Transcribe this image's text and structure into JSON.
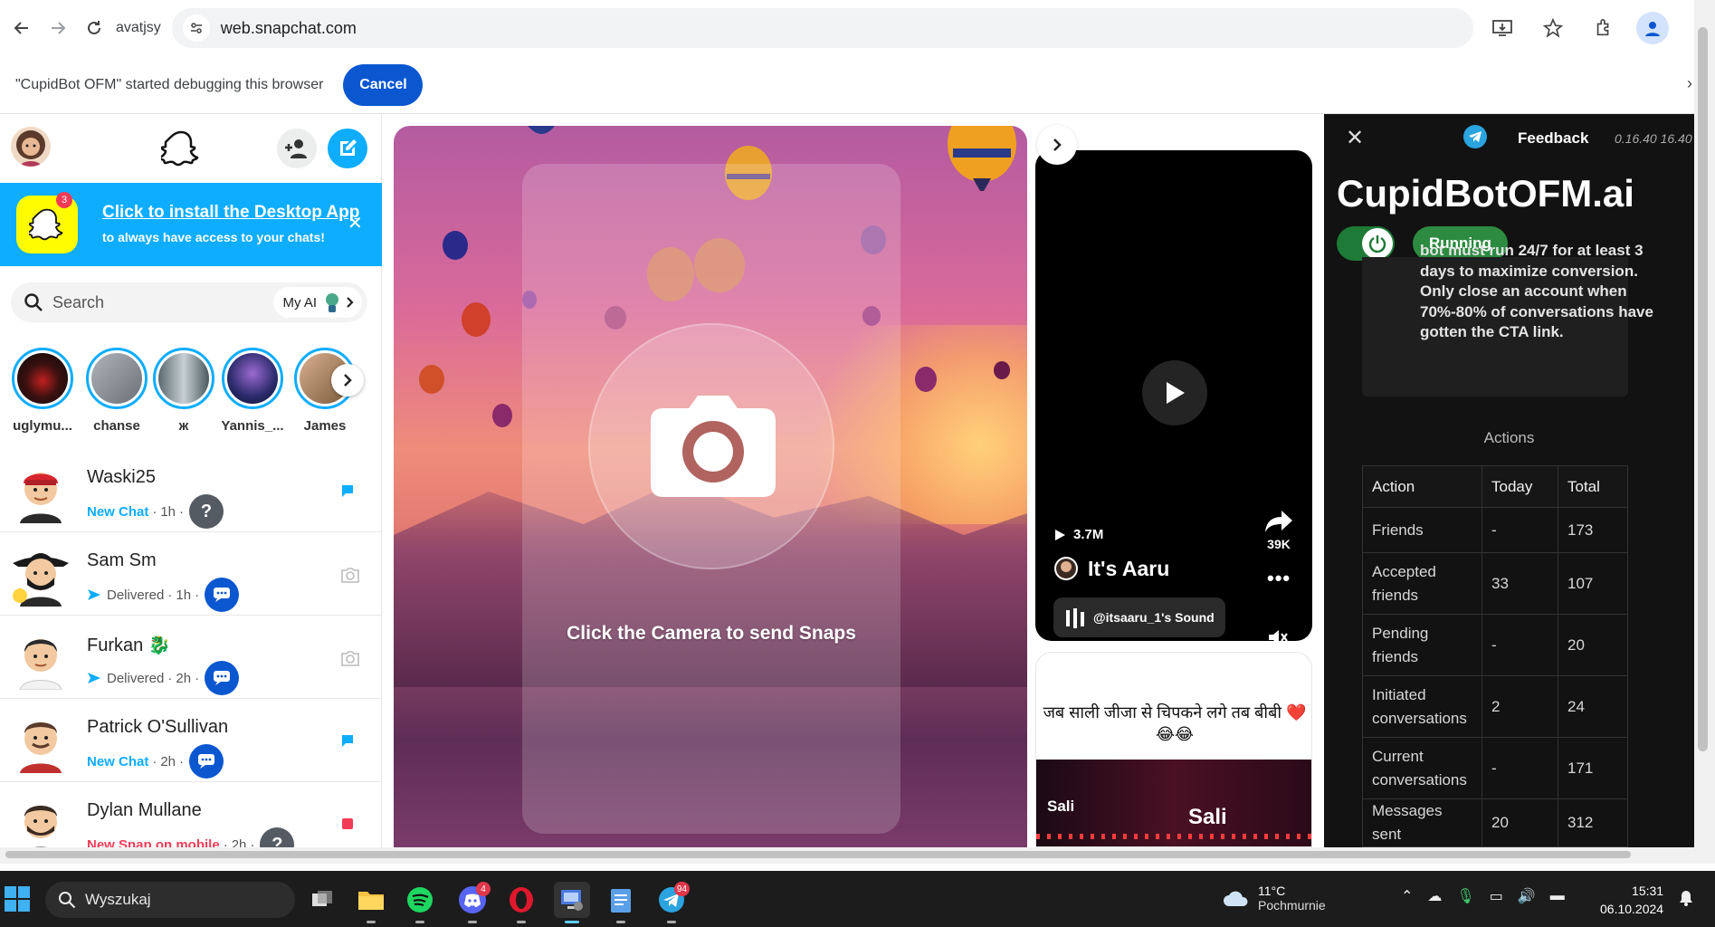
{
  "browser": {
    "profile_name": "avatjsy",
    "url": "web.snapchat.com"
  },
  "debug_bar": {
    "message": "\"CupidBot OFM\" started debugging this browser",
    "cancel_label": "Cancel"
  },
  "snapchat": {
    "install_banner": {
      "title": "Click to install the Desktop App",
      "subtitle": "to always have access to your chats!",
      "badge": "3"
    },
    "search": {
      "placeholder": "Search",
      "my_ai_label": "My AI"
    },
    "stories": [
      {
        "name": "uglymu...",
        "color": "#3a1010"
      },
      {
        "name": "chanse",
        "color": "#8a8f95"
      },
      {
        "name": "ж",
        "color": "#6e7a80"
      },
      {
        "name": "Yannis_...",
        "color": "#2a2a6a"
      },
      {
        "name": "James",
        "color": "#a07a5a"
      }
    ],
    "chats": [
      {
        "name": "Waski25",
        "status_type": "new",
        "status": "New Chat",
        "time": "1h",
        "pill": "?",
        "pill_color": "#555b63",
        "right": "blue-chat",
        "skin": "#f2c9a0",
        "hat": "#d7262f"
      },
      {
        "name": "Sam Sm",
        "status_type": "delivered",
        "status": "Delivered",
        "time": "1h",
        "pill": "chat",
        "pill_color": "#0b57d0",
        "right": "camera",
        "skin": "#f2c9a0",
        "hat": "#222"
      },
      {
        "name": "Furkan",
        "status_type": "delivered",
        "status": "Delivered",
        "time": "2h",
        "pill": "chat",
        "pill_color": "#0b57d0",
        "right": "camera",
        "skin": "#f2c9a0",
        "hat": "#2a2a2a"
      },
      {
        "name": "Patrick O'Sullivan",
        "status_type": "new",
        "status": "New Chat",
        "time": "2h",
        "pill": "chat",
        "pill_color": "#0b57d0",
        "right": "blue-chat",
        "skin": "#f2c9a0",
        "hat": "#5a3a2a"
      },
      {
        "name": "Dylan Mullane",
        "status_type": "snap",
        "status": "New Snap on mobile",
        "time": "2h",
        "pill": "?",
        "pill_color": "#555b63",
        "right": "red-snap",
        "skin": "#f2c9a0",
        "hat": "#3a2a22"
      }
    ],
    "camera_label": "Click the Camera to send Snaps",
    "spotlight": {
      "views": "3.7M",
      "shares": "39K",
      "author": "It's Aaru",
      "sound": "@itsaaru_1's Sound",
      "caption": "जब साली जीजा से चिपकने लगे तब बीबी ❤️😂😂",
      "thumb_text_1": "Sali",
      "thumb_text_2": "Sali"
    }
  },
  "cupidbot": {
    "feedback_label": "Feedback",
    "version": "0.16.40 16.40",
    "title": "CupidBotOFM.ai",
    "status": "Running",
    "notice": "bot must run 24/7 for at least 3 days to maximize conversion. Only close an account when 70%-80% of conversations have gotten the CTA link.",
    "actions_label": "Actions",
    "table": {
      "headers": [
        "Action",
        "Today",
        "Total"
      ],
      "rows": [
        [
          "Friends",
          "-",
          "173"
        ],
        [
          "Accepted friends",
          "33",
          "107"
        ],
        [
          "Pending friends",
          "-",
          "20"
        ],
        [
          "Initiated conversations",
          "2",
          "24"
        ],
        [
          "Current conversations",
          "-",
          "171"
        ],
        [
          "Messages sent",
          "20",
          "312"
        ]
      ]
    }
  },
  "taskbar": {
    "search_placeholder": "Wyszukaj",
    "discord_badge": "4",
    "telegram_badge": "94",
    "temperature": "11°C",
    "weather": "Pochmurnie",
    "time": "15:31",
    "date": "06.10.2024"
  }
}
